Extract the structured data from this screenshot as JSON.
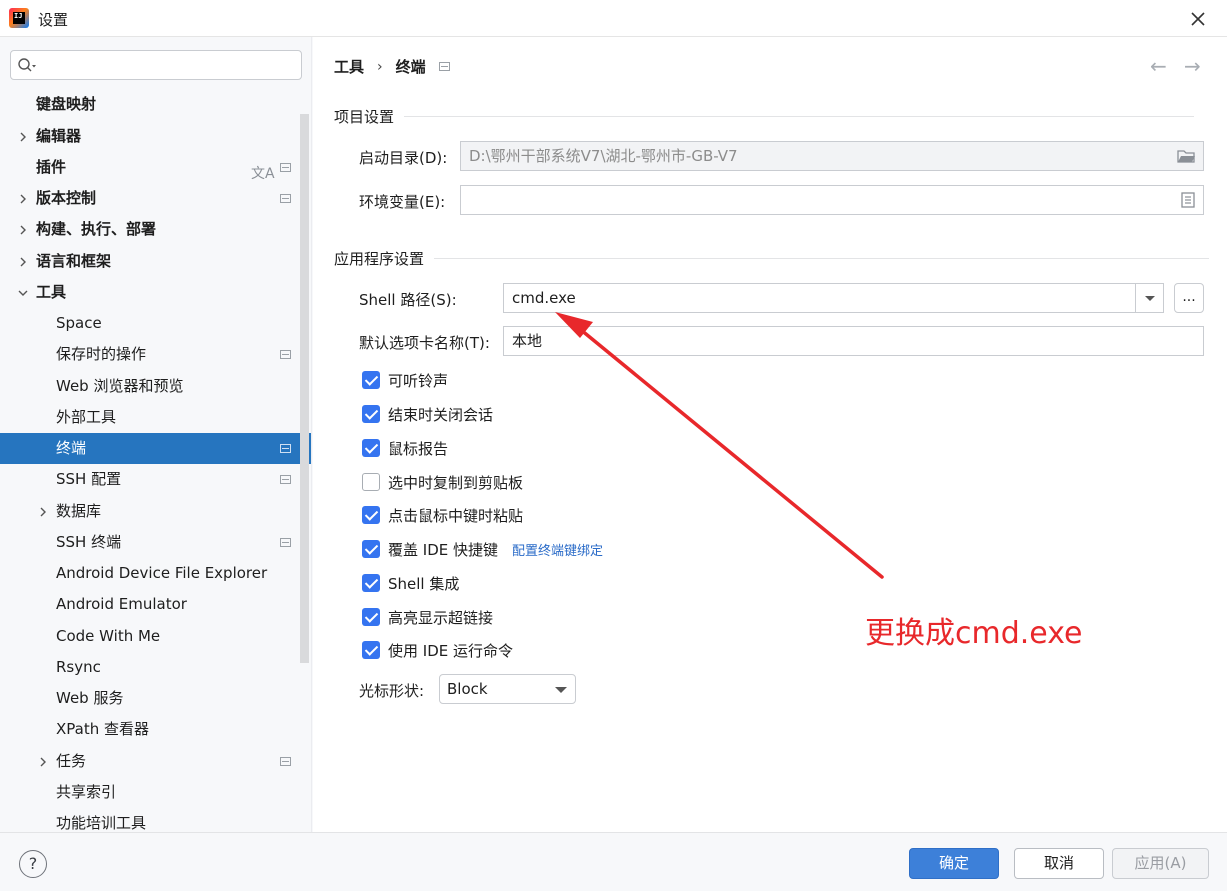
{
  "window": {
    "title": "设置"
  },
  "sidebar": {
    "search_placeholder": "",
    "items": [
      {
        "label": "键盘映射"
      },
      {
        "label": "编辑器"
      },
      {
        "label": "插件"
      },
      {
        "label": "版本控制"
      },
      {
        "label": "构建、执行、部署"
      },
      {
        "label": "语言和框架"
      },
      {
        "label": "工具"
      },
      {
        "label": "Space"
      },
      {
        "label": "保存时的操作"
      },
      {
        "label": "Web 浏览器和预览"
      },
      {
        "label": "外部工具"
      },
      {
        "label": "终端"
      },
      {
        "label": "SSH 配置"
      },
      {
        "label": "数据库"
      },
      {
        "label": "SSH 终端"
      },
      {
        "label": "Android Device File Explorer"
      },
      {
        "label": "Android Emulator"
      },
      {
        "label": "Code With Me"
      },
      {
        "label": "Rsync"
      },
      {
        "label": "Web 服务"
      },
      {
        "label": "XPath 查看器"
      },
      {
        "label": "任务"
      },
      {
        "label": "共享索引"
      },
      {
        "label": "功能培训工具"
      }
    ],
    "selected": "终端"
  },
  "breadcrumb": {
    "parent": "工具",
    "separator": "›",
    "current": "终端"
  },
  "nav": {
    "back": "←",
    "forward": "→"
  },
  "project_settings": {
    "title": "项目设置",
    "start_dir_label": "启动目录(D):",
    "start_dir_value": "D:\\鄂州干部系统V7\\湖北-鄂州市-GB-V7",
    "env_vars_label": "环境变量(E):",
    "env_vars_value": ""
  },
  "app_settings": {
    "title": "应用程序设置",
    "shell_path_label": "Shell 路径(S):",
    "shell_path_value": "cmd.exe",
    "browse_label": "...",
    "default_tab_label": "默认选项卡名称(T):",
    "default_tab_value": "本地",
    "checkboxes": [
      {
        "label": "可听铃声",
        "checked": true
      },
      {
        "label": "结束时关闭会话",
        "checked": true
      },
      {
        "label": "鼠标报告",
        "checked": true
      },
      {
        "label": "选中时复制到剪贴板",
        "checked": false
      },
      {
        "label": "点击鼠标中键时粘贴",
        "checked": true
      },
      {
        "label": "覆盖 IDE 快捷键",
        "checked": true
      },
      {
        "label": "Shell 集成",
        "checked": true
      },
      {
        "label": "高亮显示超链接",
        "checked": true
      },
      {
        "label": "使用 IDE 运行命令",
        "checked": true
      }
    ],
    "configure_keybindings_link": "配置终端键绑定",
    "cursor_shape_label": "光标形状:",
    "cursor_shape_value": "Block"
  },
  "annotation": {
    "text": "更换成cmd.exe",
    "color": "#e8282b"
  },
  "footer": {
    "help": "?",
    "ok": "确定",
    "cancel": "取消",
    "apply": "应用(A)"
  },
  "colors": {
    "accent": "#3574f0",
    "selection": "#2675bf",
    "primary_button": "#3d80d9"
  }
}
